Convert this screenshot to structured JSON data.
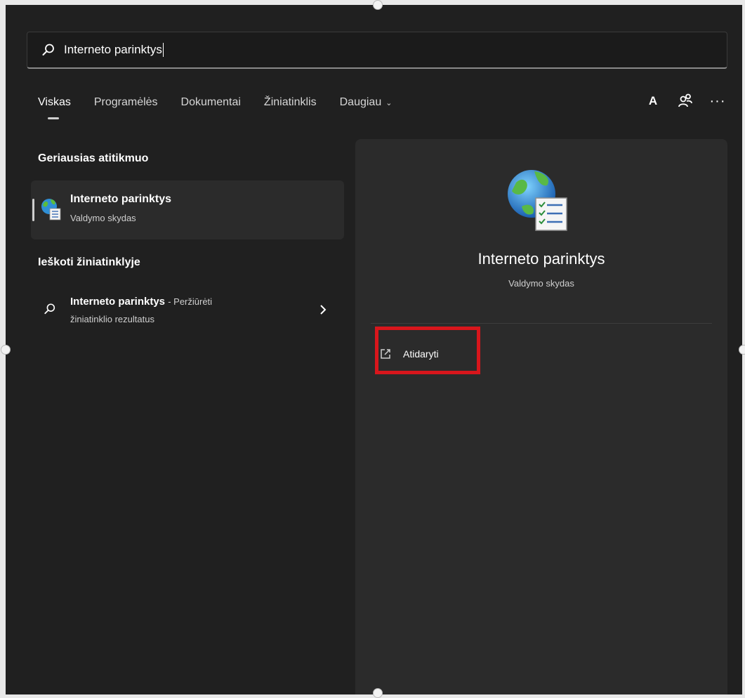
{
  "search": {
    "value": "Interneto parinktys"
  },
  "tabs": [
    {
      "label": "Viskas",
      "active": true
    },
    {
      "label": "Programėlės"
    },
    {
      "label": "Dokumentai"
    },
    {
      "label": "Žiniatinklis"
    },
    {
      "label": "Daugiau"
    }
  ],
  "toolbar": {
    "account_letter": "A",
    "more": "···"
  },
  "best_match": {
    "heading": "Geriausias atitikmuo",
    "title": "Interneto parinktys",
    "subtitle": "Valdymo skydas"
  },
  "web_search": {
    "heading": "Ieškoti žiniatinklyje",
    "title": "Interneto parinktys",
    "suffix": "- Peržiūrėti",
    "subtitle": "žiniatinklio rezultatus"
  },
  "preview": {
    "title": "Interneto parinktys",
    "subtitle": "Valdymo skydas",
    "open_label": "Atidaryti"
  },
  "colors": {
    "background": "#202020",
    "panel": "#2b2b2b",
    "highlight": "#d8161c"
  },
  "icons": [
    "search-icon",
    "internet-options-icon",
    "chevron-down-icon",
    "account-icon",
    "people-icon",
    "more-icon",
    "chevron-right-icon",
    "open-external-icon"
  ]
}
